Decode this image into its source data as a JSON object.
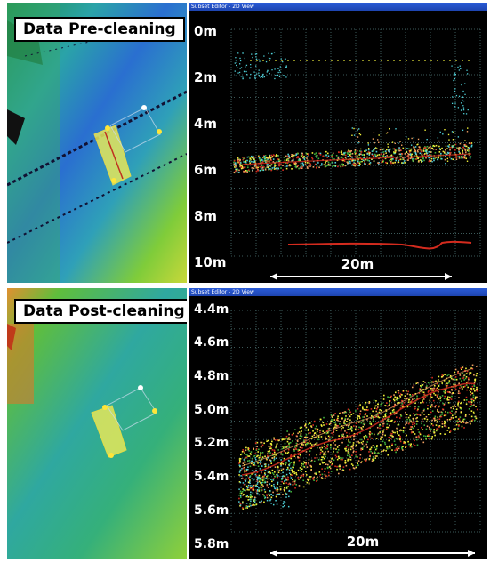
{
  "top": {
    "caption": "Data Pre-cleaning",
    "window_title": "Subset Editor - 2D View",
    "y_ticks": [
      "0m",
      "2m",
      "4m",
      "6m",
      "8m",
      "10m"
    ],
    "scale_label": "20m"
  },
  "bottom": {
    "caption": "Data Post-cleaning",
    "window_title": "Subset Editor - 2D View",
    "y_ticks": [
      "4.4m",
      "4.6m",
      "4.8m",
      "5.0m",
      "5.2m",
      "5.4m",
      "5.6m",
      "5.8m"
    ],
    "scale_label": "20m"
  },
  "colors": {
    "accent": "#2a5bd7",
    "grid": "#3d5a5a",
    "points_red": "#d42b1e",
    "points_yellow": "#f2f23a",
    "points_orange": "#f0a062",
    "points_cyan": "#4fd0d8",
    "points_green": "#3fae3a"
  }
}
